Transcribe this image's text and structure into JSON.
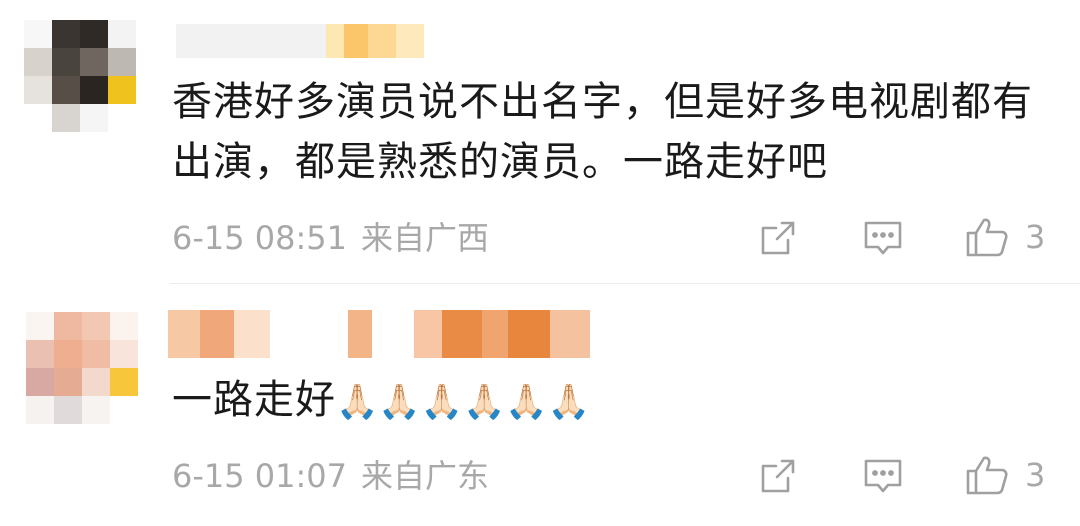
{
  "comments": [
    {
      "text_line1": "香港好多演员说不出名字，但是好多电视剧都有",
      "text_line2": "出演，都是熟悉的演员。一路走好吧",
      "time": "6-15 08:51",
      "location": "来自广西",
      "likes": "3",
      "icons": {
        "share": "share-icon",
        "comment": "comment-icon",
        "like": "thumbs-up-icon"
      }
    },
    {
      "text_main": "一路走好",
      "text_emoji": "🙏🏻🙏🏻🙏🏻🙏🏻🙏🏻🙏🏻",
      "time": "6-15 01:07",
      "location": "来自广东",
      "likes": "3",
      "icons": {
        "share": "share-icon",
        "comment": "comment-icon",
        "like": "thumbs-up-icon"
      }
    }
  ],
  "colors": {
    "text": "#1a1a1a",
    "meta": "#a8a8a8",
    "icon": "#a0a0a0",
    "divider": "#ececec"
  }
}
